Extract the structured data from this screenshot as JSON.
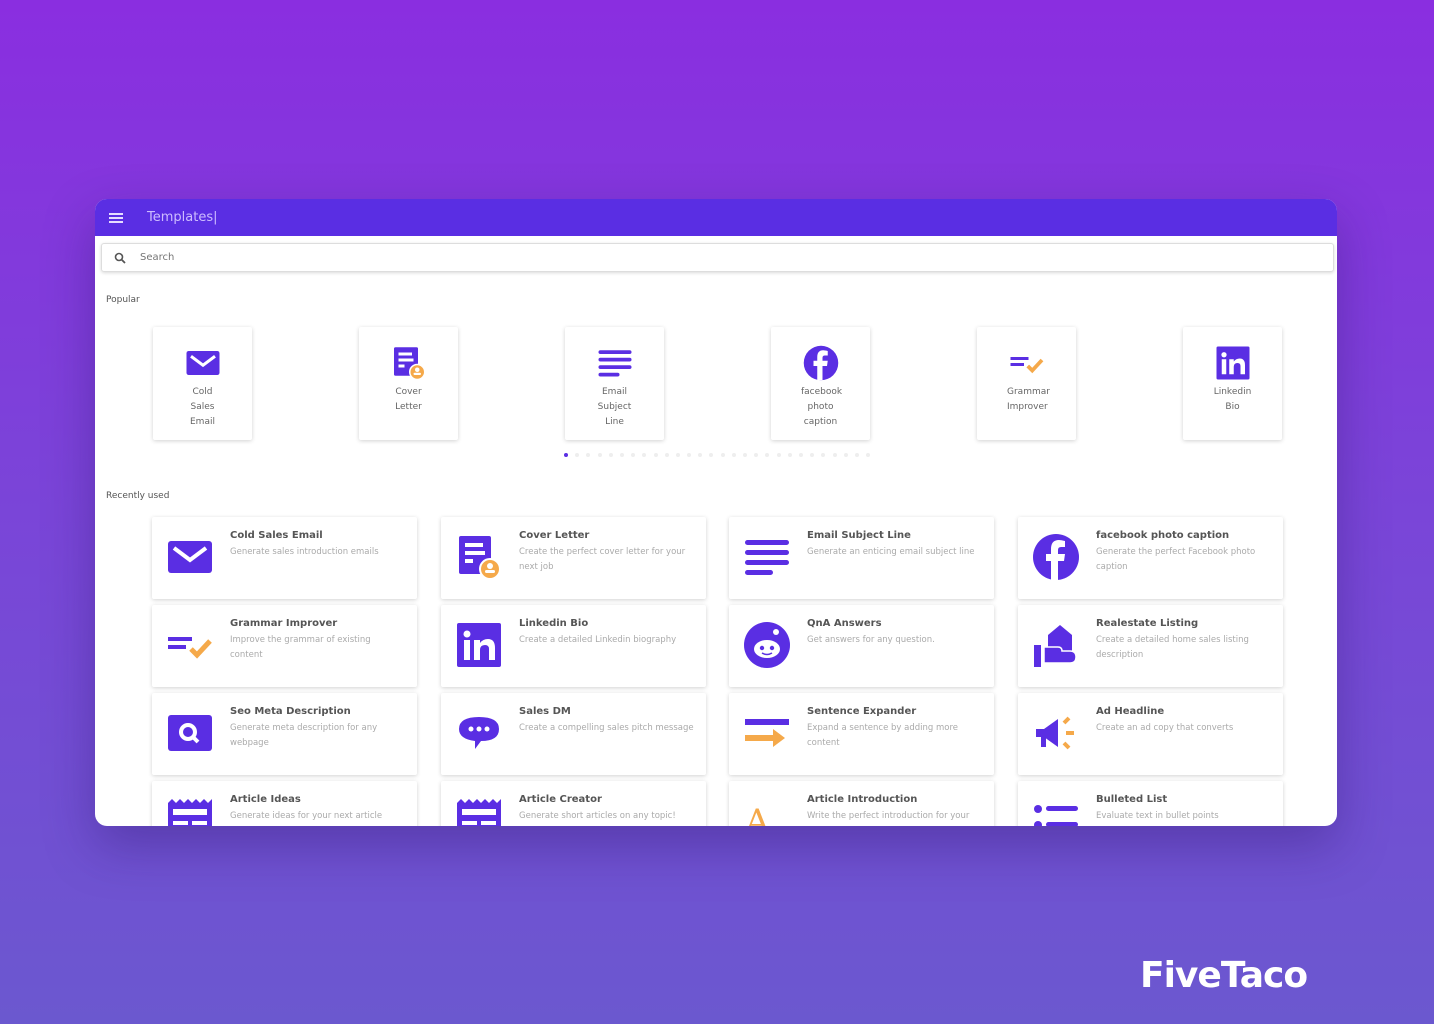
{
  "header": {
    "title": "Templates|"
  },
  "search": {
    "placeholder": "Search"
  },
  "popular": {
    "label": "Popular",
    "items": [
      {
        "label": "Cold Sales Email",
        "icon": "envelope-icon"
      },
      {
        "label": "Cover Letter",
        "icon": "cover-letter-icon"
      },
      {
        "label": "Email Subject Line",
        "icon": "lines-icon"
      },
      {
        "label": "facebook photo caption",
        "icon": "facebook-icon"
      },
      {
        "label": "Grammar Improver",
        "icon": "grammar-check-icon"
      },
      {
        "label": "Linkedin Bio",
        "icon": "linkedin-icon"
      }
    ],
    "carousel": {
      "pages": 28,
      "current": 1
    }
  },
  "recent": {
    "label": "Recently used",
    "items": [
      {
        "title": "Cold Sales Email",
        "desc": "Generate sales introduction emails",
        "icon": "envelope-icon"
      },
      {
        "title": "Cover Letter",
        "desc": "Create the perfect cover letter for your next job",
        "icon": "cover-letter-icon"
      },
      {
        "title": "Email Subject Line",
        "desc": "Generate an enticing email subject line",
        "icon": "lines-icon"
      },
      {
        "title": "facebook photo caption",
        "desc": "Generate the perfect Facebook photo caption",
        "icon": "facebook-icon"
      },
      {
        "title": "Grammar Improver",
        "desc": "Improve the grammar of existing content",
        "icon": "grammar-check-icon"
      },
      {
        "title": "Linkedin Bio",
        "desc": "Create a detailed Linkedin biography",
        "icon": "linkedin-icon"
      },
      {
        "title": "QnA Answers",
        "desc": "Get answers for any question.",
        "icon": "reddit-icon"
      },
      {
        "title": "Realestate Listing",
        "desc": "Create a detailed home sales listing description",
        "icon": "house-hand-icon"
      },
      {
        "title": "Seo Meta Description",
        "desc": "Generate meta description for any webpage",
        "icon": "search-box-icon"
      },
      {
        "title": "Sales DM",
        "desc": "Create a compelling sales pitch message",
        "icon": "chat-bubble-icon"
      },
      {
        "title": "Sentence Expander",
        "desc": "Expand a sentence by adding more content",
        "icon": "expand-arrow-icon"
      },
      {
        "title": "Ad Headline",
        "desc": "Create an ad copy that converts",
        "icon": "megaphone-icon"
      },
      {
        "title": "Article Ideas",
        "desc": "Generate ideas for your next article",
        "icon": "newspaper-icon"
      },
      {
        "title": "Article Creator",
        "desc": "Generate short articles on any topic!",
        "icon": "newspaper-icon"
      },
      {
        "title": "Article Introduction",
        "desc": "Write the perfect introduction for your",
        "icon": "text-a-icon"
      },
      {
        "title": "Bulleted List",
        "desc": "Evaluate text in bullet points",
        "icon": "bullet-list-icon"
      }
    ]
  },
  "brand": "FiveTaco",
  "colors": {
    "primary": "#5a2ee3",
    "accent": "#f5a94a"
  }
}
